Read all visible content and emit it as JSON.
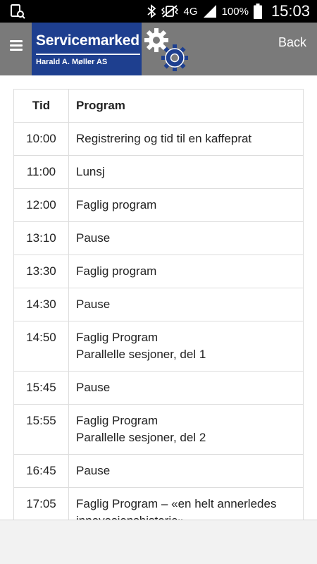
{
  "status_bar": {
    "network_label": "4G",
    "battery_percent": "100%",
    "time": "15:03"
  },
  "header": {
    "logo_title": "Servicemarked",
    "logo_subtitle": "Harald A. Møller AS",
    "back_label": "Back"
  },
  "table": {
    "headers": [
      "Tid",
      "Program"
    ],
    "rows": [
      {
        "time": "10:00",
        "lines": [
          "Registrering og tid til en kaffeprat"
        ]
      },
      {
        "time": "11:00",
        "lines": [
          "Lunsj"
        ]
      },
      {
        "time": "12:00",
        "lines": [
          "Faglig program"
        ]
      },
      {
        "time": "13:10",
        "lines": [
          "Pause"
        ]
      },
      {
        "time": "13:30",
        "lines": [
          "Faglig program"
        ]
      },
      {
        "time": "14:30",
        "lines": [
          "Pause"
        ]
      },
      {
        "time": "14:50",
        "lines": [
          "Faglig Program",
          "Parallelle sesjoner, del 1"
        ]
      },
      {
        "time": "15:45",
        "lines": [
          "Pause"
        ]
      },
      {
        "time": "15:55",
        "lines": [
          "Faglig Program",
          "Parallelle sesjoner, del 2"
        ]
      },
      {
        "time": "16:45",
        "lines": [
          "Pause"
        ]
      },
      {
        "time": "17:05",
        "lines": [
          "Faglig Program – «en helt annerledes",
          "innovasjonshistorie»"
        ]
      }
    ]
  },
  "icons": {
    "status_left": "notification-icon",
    "bluetooth": "bluetooth-icon",
    "vibrate": "vibrate-icon",
    "signal": "signal-icon",
    "battery": "battery-icon",
    "menu": "hamburger-menu-icon",
    "gears": "gears-icon"
  }
}
